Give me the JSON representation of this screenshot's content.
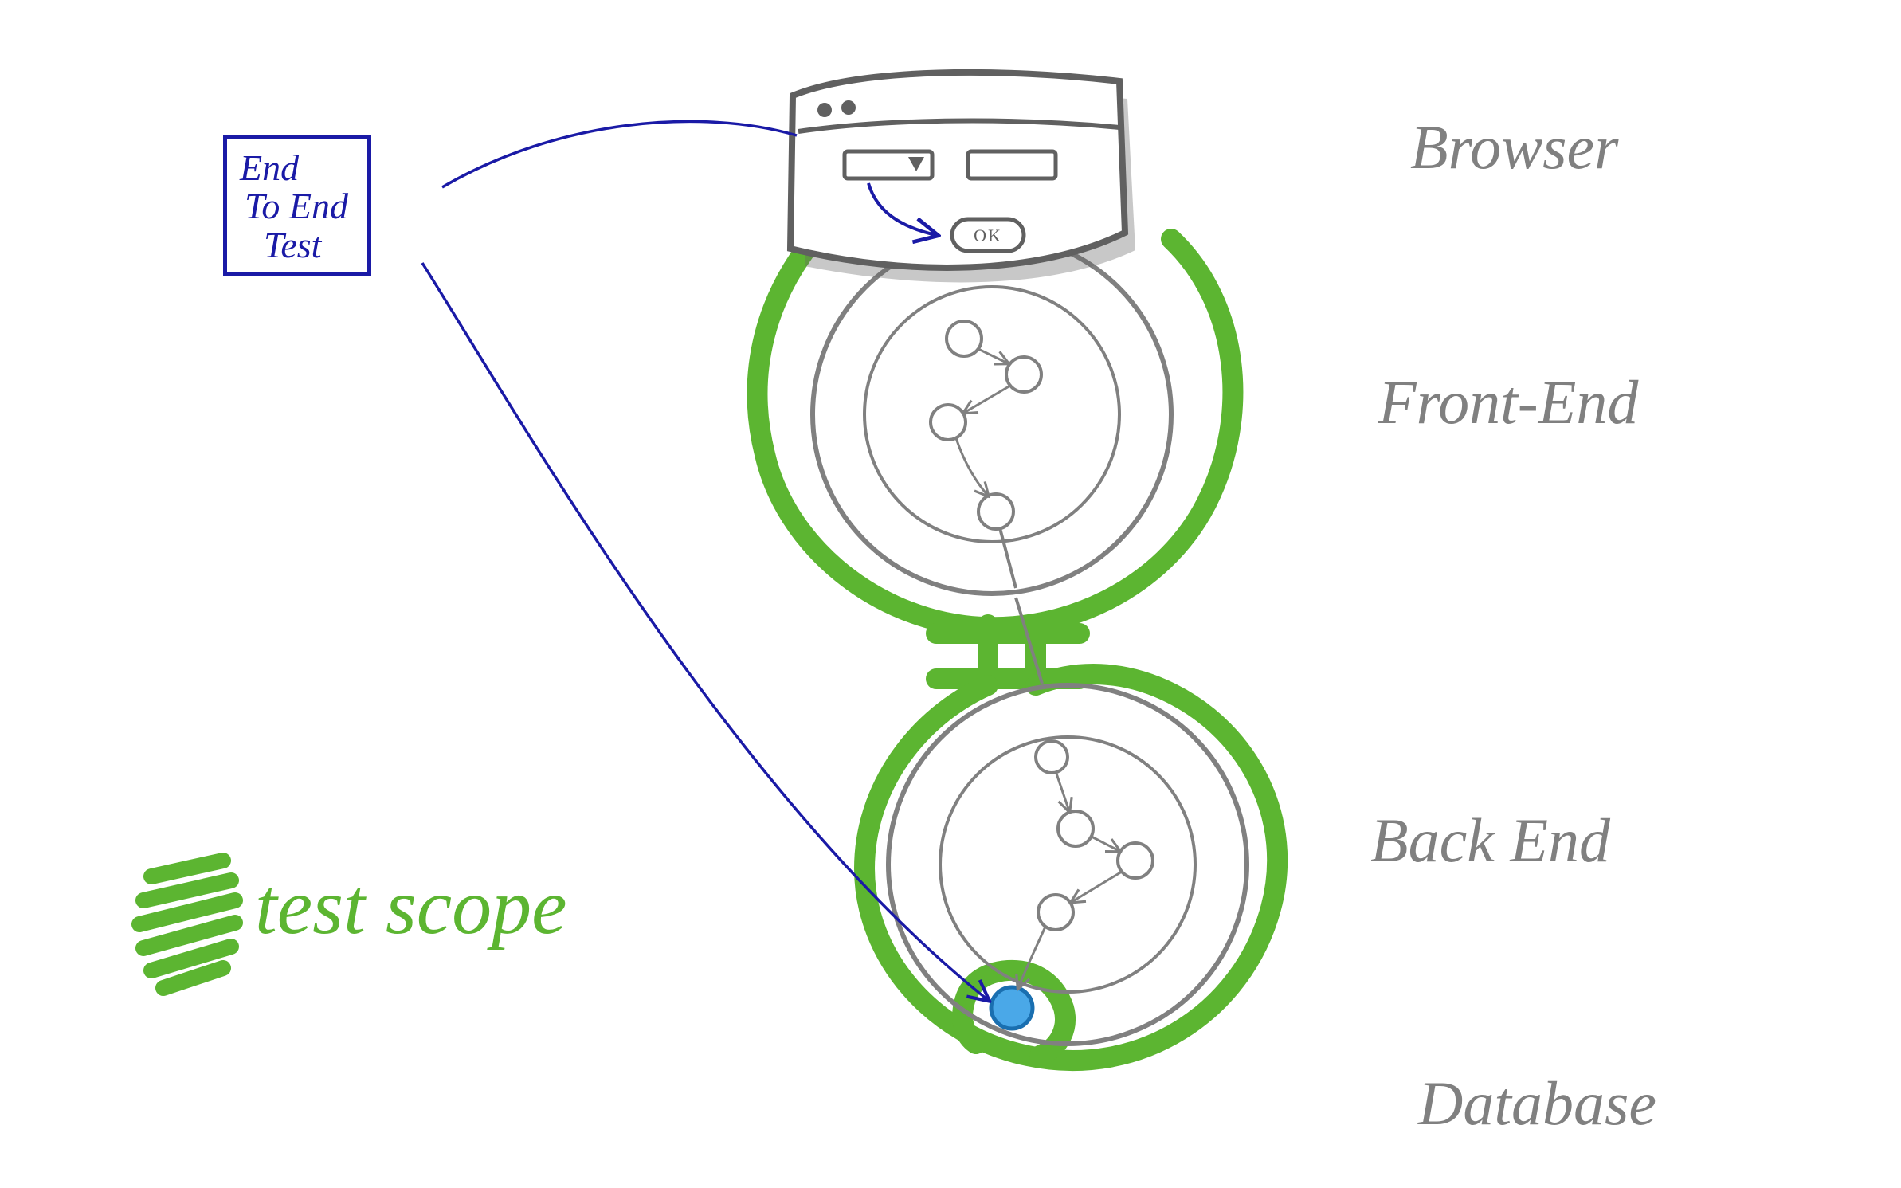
{
  "layers": {
    "browser": "Browser",
    "frontend": "Front-End",
    "backend": "Back End",
    "database": "Database"
  },
  "test_box": {
    "line1": "End",
    "line2": "To End",
    "line3": "Test"
  },
  "legend": {
    "label": "test scope"
  },
  "browser_button": "OK",
  "colors": {
    "scope_green": "#5cb531",
    "test_blue": "#1a1aa6",
    "sketch_gray": "#808080",
    "node_blue_fill": "#4aa8e8",
    "node_blue_stroke": "#1a6fb0"
  }
}
